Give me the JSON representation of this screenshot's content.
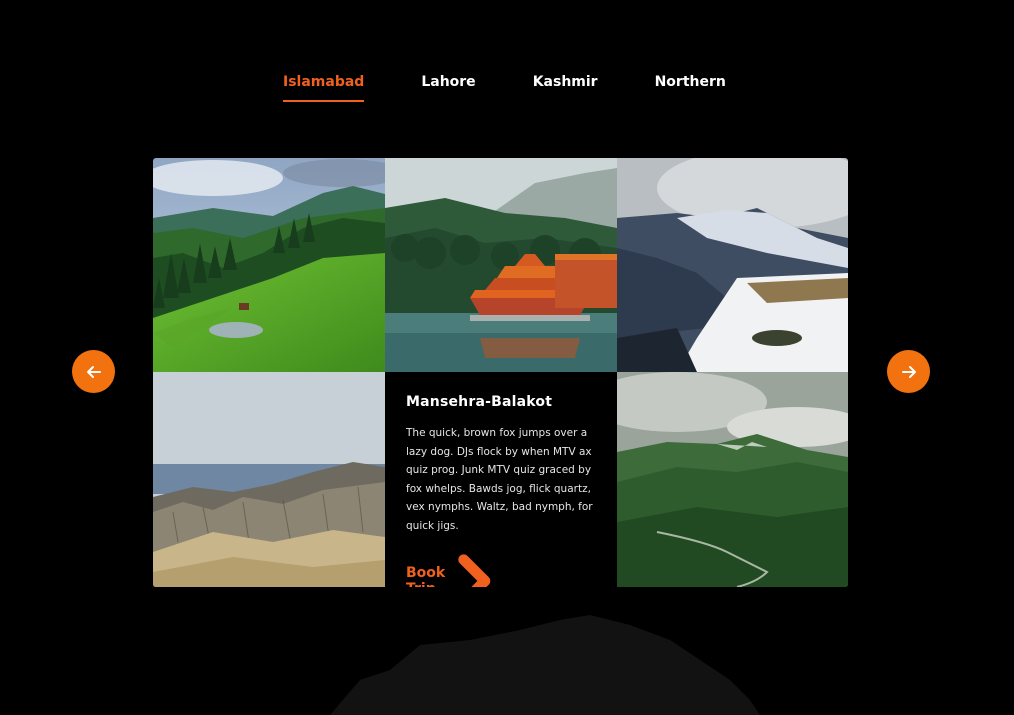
{
  "nav": {
    "tabs": [
      {
        "label": "Islamabad",
        "active": true
      },
      {
        "label": "Lahore",
        "active": false
      },
      {
        "label": "Kashmir",
        "active": false
      },
      {
        "label": "Northern",
        "active": false
      }
    ]
  },
  "feature": {
    "title": "Mansehra-Balakot",
    "description": "The quick, brown fox jumps over a lazy dog. DJs flock by when MTV ax quiz prog. Junk MTV quiz graced by fox whelps. Bawds jog, flick quartz, vex nymphs. Waltz, bad nymph, for quick jigs.",
    "cta_label": "Book Trip",
    "cta_icon": "chevron-right-icon"
  },
  "controls": {
    "prev_icon": "arrow-left-icon",
    "next_icon": "arrow-right-icon"
  },
  "colors": {
    "accent": "#f0601e",
    "background": "#000000",
    "text": "#ffffff"
  }
}
